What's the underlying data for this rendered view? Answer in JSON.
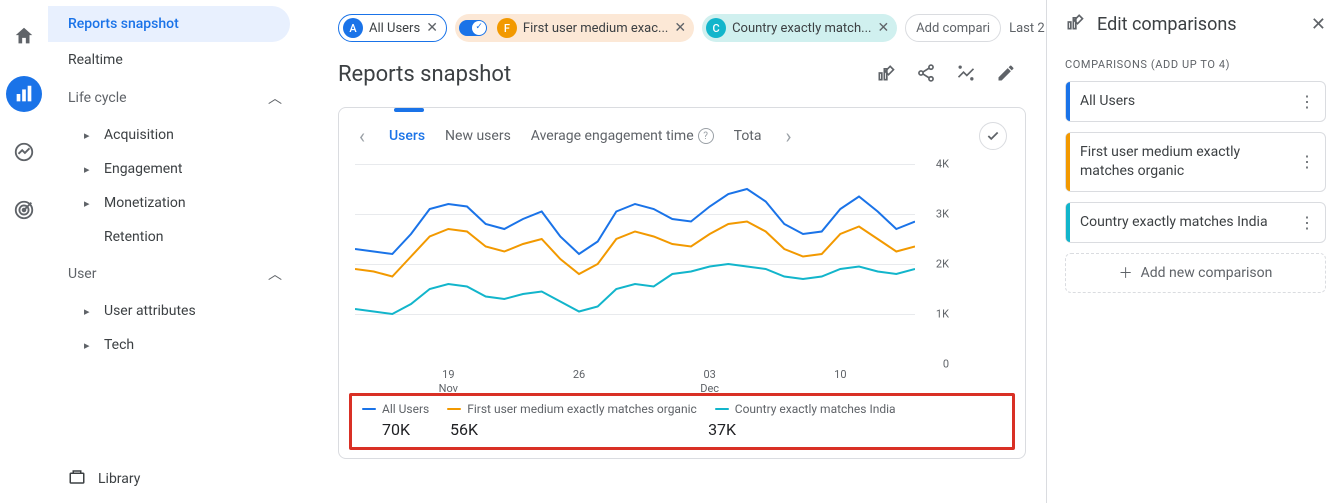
{
  "colors": {
    "blue": "#1a73e8",
    "orange": "#f29900",
    "teal": "#12b5cb"
  },
  "sidebar": {
    "reports_snapshot": "Reports snapshot",
    "realtime": "Realtime",
    "lifecycle_label": "Life cycle",
    "acquisition": "Acquisition",
    "engagement": "Engagement",
    "monetization": "Monetization",
    "retention": "Retention",
    "user_label": "User",
    "user_attributes": "User attributes",
    "tech": "Tech",
    "library": "Library"
  },
  "chips": {
    "all_users_badge": "A",
    "all_users": "All Users",
    "first_badge": "F",
    "first": "First user medium exac...",
    "country_badge": "C",
    "country": "Country exactly match...",
    "add": "Add compari",
    "last": "Last 2"
  },
  "title": "Reports snapshot",
  "tabs": {
    "users": "Users",
    "new_users": "New users",
    "avg_engagement": "Average engagement time",
    "total": "Tota"
  },
  "chart_data": {
    "type": "line",
    "ylim": [
      0,
      4000
    ],
    "yticks": [
      "0",
      "1K",
      "2K",
      "3K",
      "4K"
    ],
    "xticks": [
      {
        "d": "19",
        "m": "Nov"
      },
      {
        "d": "26",
        "m": ""
      },
      {
        "d": "03",
        "m": "Dec"
      },
      {
        "d": "10",
        "m": ""
      }
    ],
    "series": [
      {
        "name": "All Users",
        "color": "#1a73e8",
        "total": "70K",
        "values": [
          2300,
          2250,
          2200,
          2600,
          3100,
          3200,
          3150,
          2800,
          2700,
          2900,
          3050,
          2550,
          2200,
          2450,
          3050,
          3200,
          3100,
          2900,
          2850,
          3150,
          3400,
          3500,
          3250,
          2800,
          2600,
          2650,
          3100,
          3350,
          3050,
          2700,
          2850
        ]
      },
      {
        "name": "First user medium exactly matches organic",
        "color": "#f29900",
        "total": "56K",
        "values": [
          1900,
          1850,
          1750,
          2150,
          2550,
          2700,
          2650,
          2350,
          2250,
          2400,
          2500,
          2100,
          1800,
          2000,
          2500,
          2650,
          2550,
          2400,
          2350,
          2600,
          2800,
          2850,
          2650,
          2300,
          2150,
          2200,
          2600,
          2750,
          2500,
          2250,
          2350
        ]
      },
      {
        "name": "Country exactly matches India",
        "color": "#12b5cb",
        "total": "37K",
        "values": [
          1100,
          1050,
          1000,
          1200,
          1500,
          1600,
          1550,
          1350,
          1300,
          1400,
          1450,
          1250,
          1050,
          1150,
          1500,
          1600,
          1550,
          1800,
          1850,
          1950,
          2000,
          1950,
          1900,
          1750,
          1700,
          1750,
          1900,
          1950,
          1850,
          1800,
          1900
        ]
      }
    ]
  },
  "panel": {
    "title": "Edit comparisons",
    "subtitle": "COMPARISONS (ADD UP TO 4)",
    "items": [
      {
        "label": "All Users",
        "color": "#1a73e8"
      },
      {
        "label": "First user medium exactly matches organic",
        "color": "#f29900"
      },
      {
        "label": "Country exactly matches India",
        "color": "#12b5cb"
      }
    ],
    "add": "Add new comparison"
  }
}
